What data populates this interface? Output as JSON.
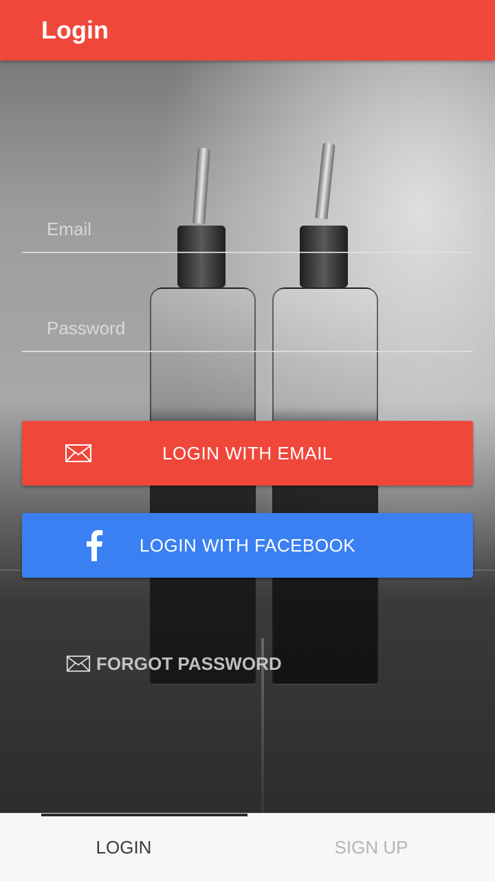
{
  "app_bar": {
    "title": "Login"
  },
  "form": {
    "email_placeholder": "Email",
    "email_value": "",
    "password_placeholder": "Password",
    "password_value": ""
  },
  "buttons": {
    "login_email": {
      "label": "LOGIN WITH EMAIL",
      "icon": "envelope-icon"
    },
    "login_facebook": {
      "label": "LOGIN WITH FACEBOOK",
      "icon": "facebook-icon"
    }
  },
  "forgot_password": {
    "label": "FORGOT PASSWORD",
    "icon": "envelope-icon"
  },
  "tabs": [
    {
      "label": "LOGIN",
      "active": true
    },
    {
      "label": "SIGN UP",
      "active": false
    }
  ],
  "colors": {
    "accent": "#f0473b",
    "facebook": "#3b80f2",
    "tab_bar": "#f7f7f7"
  }
}
